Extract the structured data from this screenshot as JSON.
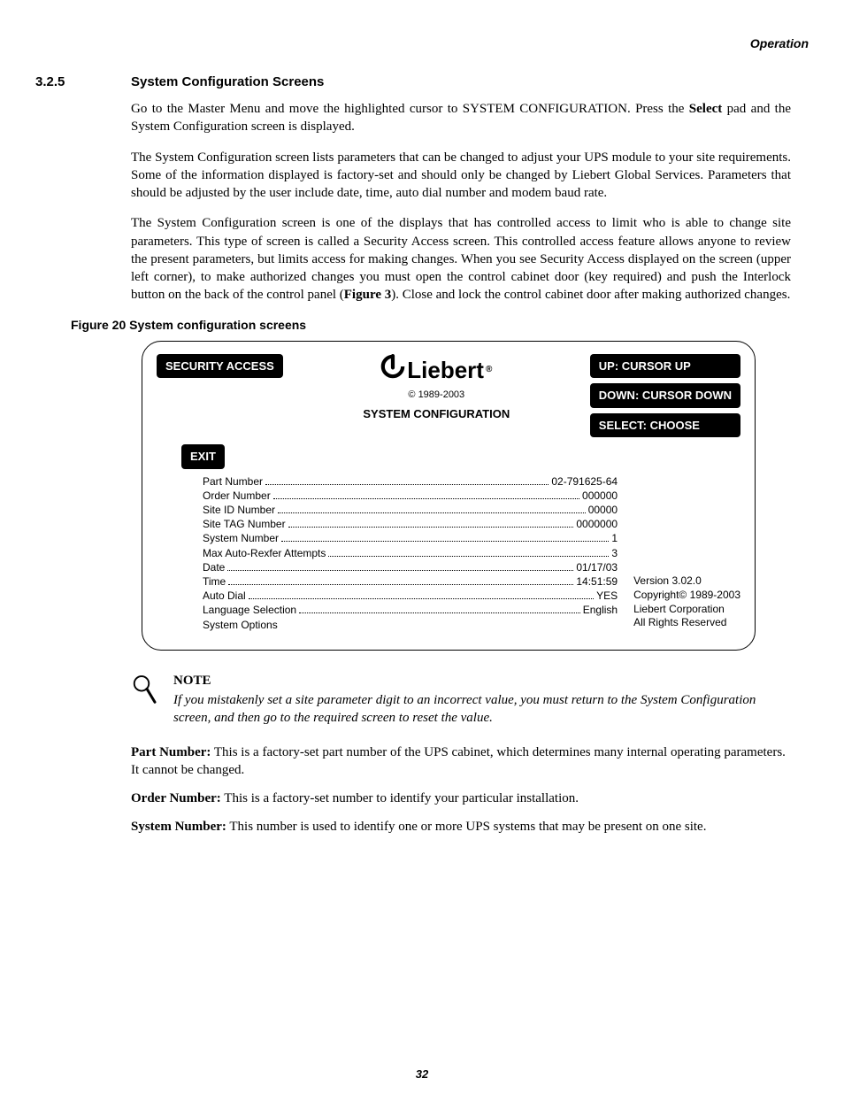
{
  "header": {
    "section": "Operation"
  },
  "section": {
    "number": "3.2.5",
    "title": "System Configuration Screens"
  },
  "paragraphs": {
    "p1a": "Go to the Master Menu and move the highlighted cursor to SYSTEM CONFIGURATION. Press the ",
    "p1b": "Select",
    "p1c": " pad and the System Configuration screen is displayed.",
    "p2": "The System Configuration screen lists parameters that can be changed to adjust your UPS module to your site requirements. Some of the information displayed is factory-set and should only be changed by Liebert Global Services. Parameters that should be adjusted by the user include date, time, auto dial number and modem baud rate.",
    "p3a": "The System Configuration screen is one of the displays that has controlled access to limit who is able to change site parameters. This type of screen is called a Security Access screen. This controlled access feature allows anyone to review the present parameters, but limits access for making changes. When you see Security Access displayed on the screen (upper left corner), to make authorized changes you must open the control cabinet door (key required) and push the Interlock button on the back of the control panel (",
    "p3b": "Figure 3",
    "p3c": "). Close and lock the control cabinet door after making authorized changes."
  },
  "figure": {
    "caption": "Figure 20  System configuration screens",
    "security_access": "SECURITY ACCESS",
    "logo_text": "Liebert",
    "logo_copyright": "© 1989-2003",
    "screen_title": "SYSTEM CONFIGURATION",
    "nav": {
      "up": "UP: CURSOR UP",
      "down": "DOWN: CURSOR DOWN",
      "select": "SELECT: CHOOSE"
    },
    "exit": "EXIT",
    "params": [
      {
        "label": "Part Number",
        "value": "02-791625-64"
      },
      {
        "label": "Order Number",
        "value": "000000"
      },
      {
        "label": "Site ID Number",
        "value": "00000"
      },
      {
        "label": "Site TAG Number",
        "value": "0000000"
      },
      {
        "label": "System Number",
        "value": "1"
      },
      {
        "label": "Max Auto-Rexfer Attempts",
        "value": "3"
      },
      {
        "label": "Date",
        "value": "01/17/03"
      },
      {
        "label": "Time",
        "value": "14:51:59"
      },
      {
        "label": "Auto Dial",
        "value": "YES"
      },
      {
        "label": "Language Selection",
        "value": "English"
      }
    ],
    "last_line": "System Options",
    "version": {
      "line1": "Version 3.02.0",
      "line2": "Copyright© 1989-2003",
      "line3": "Liebert Corporation",
      "line4": "All Rights Reserved"
    }
  },
  "note": {
    "head": "NOTE",
    "body": "If you mistakenly set a site parameter digit to an incorrect value, you must return to the System Configuration screen, and then go to the required screen to reset the value."
  },
  "defs": {
    "d1_term": "Part Number:",
    "d1_text": " This is a factory-set part number of the UPS cabinet, which determines many internal operating parameters. It cannot be changed.",
    "d2_term": "Order Number:",
    "d2_text": " This is a factory-set number to identify your particular installation.",
    "d3_term": "System Number:",
    "d3_text": " This number is used to identify one or more UPS systems that may be present on one site."
  },
  "page_number": "32"
}
